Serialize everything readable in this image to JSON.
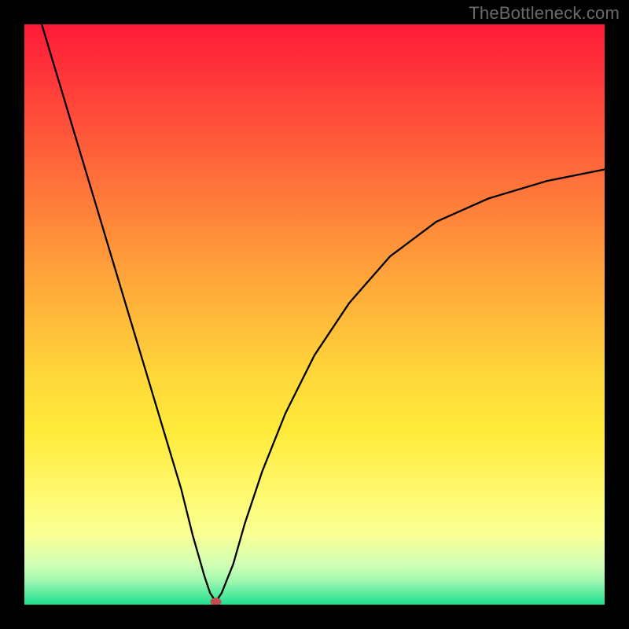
{
  "watermark": "TheBottleneck.com",
  "chart_data": {
    "type": "line",
    "title": "",
    "xlabel": "",
    "ylabel": "",
    "xlim": [
      0,
      100
    ],
    "ylim": [
      0,
      100
    ],
    "series": [
      {
        "name": "bottleneck-curve",
        "x": [
          3,
          6,
          9,
          12,
          15,
          18,
          21,
          24,
          27,
          29,
          31,
          32,
          33,
          34,
          36,
          38,
          41,
          45,
          50,
          56,
          63,
          71,
          80,
          90,
          100
        ],
        "y": [
          100,
          90,
          80,
          70,
          60,
          50,
          40,
          30,
          20,
          12,
          5,
          2,
          0.5,
          2,
          7,
          14,
          23,
          33,
          43,
          52,
          60,
          66,
          70,
          73,
          75
        ]
      }
    ],
    "annotations": [
      {
        "name": "min-marker",
        "x": 33,
        "y": 0.5
      }
    ],
    "background_gradient": {
      "top": "#ff1a38",
      "bottom": "#1ee08f"
    }
  }
}
